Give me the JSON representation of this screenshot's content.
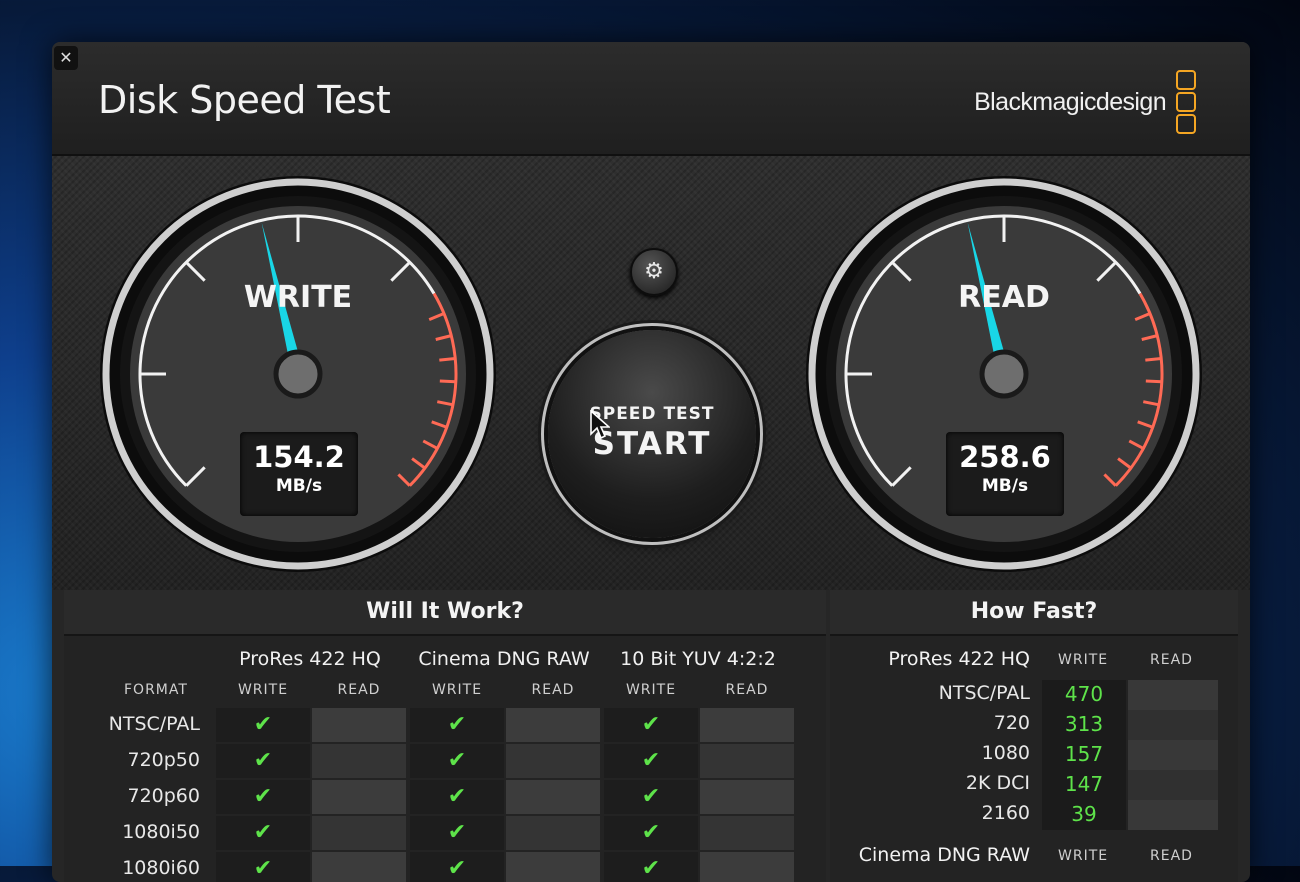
{
  "window": {
    "title": "Disk Speed Test",
    "brand": "Blackmagicdesign",
    "accent": "#f5a623"
  },
  "write_gauge": {
    "label": "WRITE",
    "value": "154.2",
    "unit": "MB/s",
    "needle_fraction": 0.45
  },
  "read_gauge": {
    "label": "READ",
    "value": "258.6",
    "unit": "MB/s",
    "needle_fraction": 0.45
  },
  "controls": {
    "settings_icon": "gear-icon",
    "start_line1": "SPEED TEST",
    "start_line2": "START"
  },
  "will_it_work": {
    "title": "Will It Work?",
    "codecs": [
      "ProRes 422 HQ",
      "Cinema DNG RAW",
      "10 Bit YUV 4:2:2"
    ],
    "format_header": "FORMAT",
    "write_label": "WRITE",
    "read_label": "READ",
    "check_glyph": "✔",
    "rows": [
      {
        "format": "NTSC/PAL"
      },
      {
        "format": "720p50"
      },
      {
        "format": "720p60"
      },
      {
        "format": "1080i50"
      },
      {
        "format": "1080i60"
      }
    ]
  },
  "how_fast": {
    "title": "How Fast?",
    "codec": "ProRes 422 HQ",
    "write_label": "WRITE",
    "read_label": "READ",
    "rows": [
      {
        "format": "NTSC/PAL",
        "write": "470"
      },
      {
        "format": "720",
        "write": "313"
      },
      {
        "format": "1080",
        "write": "157"
      },
      {
        "format": "2K DCI",
        "write": "147"
      },
      {
        "format": "2160",
        "write": "39"
      }
    ],
    "next_codec": "Cinema DNG RAW"
  }
}
